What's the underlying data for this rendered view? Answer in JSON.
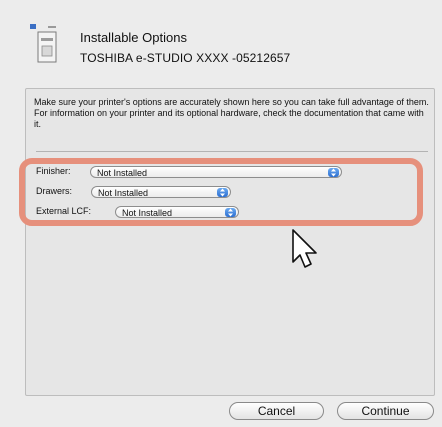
{
  "header": {
    "title": "Installable Options",
    "printer_name": "TOSHIBA e-STUDIO XXXX -05212657",
    "printer_icon": "printer-icon"
  },
  "description": "Make sure your printer's options are accurately shown here so you can take full advantage of them.  For information on your printer and its optional hardware, check the documentation that came with it.",
  "options": [
    {
      "label": "Finisher:",
      "value": "Not Installed"
    },
    {
      "label": "Drawers:",
      "value": "Not Installed"
    },
    {
      "label": "External LCF:",
      "value": "Not Installed"
    }
  ],
  "buttons": {
    "cancel": "Cancel",
    "continue": "Continue"
  },
  "colors": {
    "highlight": "#e6907c",
    "popup_arrow": "#2d6fd1"
  }
}
